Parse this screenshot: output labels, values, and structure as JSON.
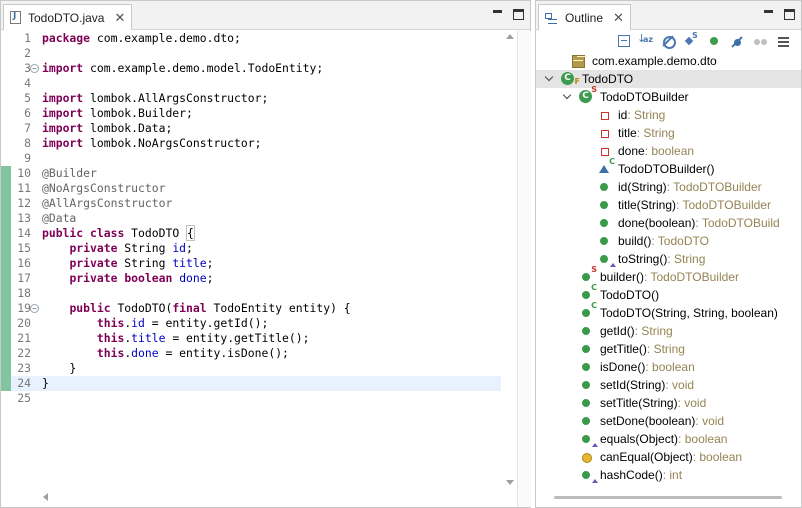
{
  "editor": {
    "tab_title": "TodoDTO.java",
    "tab_close": "✕",
    "lines": [
      {
        "n": "1",
        "segs": [
          {
            "t": "package",
            "c": "kw"
          },
          {
            "t": " com.example.demo.dto;"
          }
        ]
      },
      {
        "n": "2",
        "segs": []
      },
      {
        "n": "3",
        "fold": true,
        "segs": [
          {
            "t": "import",
            "c": "kw"
          },
          {
            "t": " com.example.demo.model.TodoEntity;"
          }
        ]
      },
      {
        "n": "4",
        "segs": []
      },
      {
        "n": "5",
        "segs": [
          {
            "t": "import",
            "c": "kw"
          },
          {
            "t": " lombok.AllArgsConstructor;"
          }
        ]
      },
      {
        "n": "6",
        "segs": [
          {
            "t": "import",
            "c": "kw"
          },
          {
            "t": " lombok.Builder;"
          }
        ]
      },
      {
        "n": "7",
        "segs": [
          {
            "t": "import",
            "c": "kw"
          },
          {
            "t": " lombok.Data;"
          }
        ]
      },
      {
        "n": "8",
        "segs": [
          {
            "t": "import",
            "c": "kw"
          },
          {
            "t": " lombok.NoArgsConstructor;"
          }
        ]
      },
      {
        "n": "9",
        "segs": []
      },
      {
        "n": "10",
        "mark": true,
        "segs": [
          {
            "t": "@Builder",
            "c": "ann"
          }
        ]
      },
      {
        "n": "11",
        "mark": true,
        "segs": [
          {
            "t": "@NoArgsConstructor",
            "c": "ann"
          }
        ]
      },
      {
        "n": "12",
        "mark": true,
        "segs": [
          {
            "t": "@AllArgsConstructor",
            "c": "ann"
          }
        ]
      },
      {
        "n": "13",
        "mark": true,
        "segs": [
          {
            "t": "@Data",
            "c": "ann"
          }
        ]
      },
      {
        "n": "14",
        "mark": true,
        "segs": [
          {
            "t": "public",
            "c": "kw"
          },
          {
            "t": " "
          },
          {
            "t": "class",
            "c": "kw"
          },
          {
            "t": " TodoDTO "
          },
          {
            "t": "{",
            "c": "cursor-box"
          }
        ]
      },
      {
        "n": "15",
        "mark": true,
        "segs": [
          {
            "t": "    "
          },
          {
            "t": "private",
            "c": "kw"
          },
          {
            "t": " String "
          },
          {
            "t": "id",
            "c": "fld"
          },
          {
            "t": ";"
          }
        ]
      },
      {
        "n": "16",
        "mark": true,
        "segs": [
          {
            "t": "    "
          },
          {
            "t": "private",
            "c": "kw"
          },
          {
            "t": " String "
          },
          {
            "t": "title",
            "c": "fld"
          },
          {
            "t": ";"
          }
        ]
      },
      {
        "n": "17",
        "mark": true,
        "segs": [
          {
            "t": "    "
          },
          {
            "t": "private",
            "c": "kw"
          },
          {
            "t": " "
          },
          {
            "t": "boolean",
            "c": "kw"
          },
          {
            "t": " "
          },
          {
            "t": "done",
            "c": "fld"
          },
          {
            "t": ";"
          }
        ]
      },
      {
        "n": "18",
        "mark": true,
        "segs": []
      },
      {
        "n": "19",
        "mark": true,
        "fold": true,
        "segs": [
          {
            "t": "    "
          },
          {
            "t": "public",
            "c": "kw"
          },
          {
            "t": " TodoDTO("
          },
          {
            "t": "final",
            "c": "kw"
          },
          {
            "t": " TodoEntity entity) {"
          }
        ]
      },
      {
        "n": "20",
        "mark": true,
        "segs": [
          {
            "t": "        "
          },
          {
            "t": "this",
            "c": "kw"
          },
          {
            "t": "."
          },
          {
            "t": "id",
            "c": "fld"
          },
          {
            "t": " = entity.getId();"
          }
        ]
      },
      {
        "n": "21",
        "mark": true,
        "segs": [
          {
            "t": "        "
          },
          {
            "t": "this",
            "c": "kw"
          },
          {
            "t": "."
          },
          {
            "t": "title",
            "c": "fld"
          },
          {
            "t": " = entity.getTitle();"
          }
        ]
      },
      {
        "n": "22",
        "mark": true,
        "segs": [
          {
            "t": "        "
          },
          {
            "t": "this",
            "c": "kw"
          },
          {
            "t": "."
          },
          {
            "t": "done",
            "c": "fld"
          },
          {
            "t": " = entity.isDone();"
          }
        ]
      },
      {
        "n": "23",
        "mark": true,
        "segs": [
          {
            "t": "    }"
          }
        ]
      },
      {
        "n": "24",
        "mark": true,
        "current": true,
        "segs": [
          {
            "t": "}"
          }
        ]
      },
      {
        "n": "25",
        "segs": []
      }
    ]
  },
  "outline": {
    "tab_title": "Outline",
    "tab_close": "✕",
    "toolbar": [
      "collapse-all",
      "sort",
      "hide-fields",
      "hide-static",
      "hide-non-public",
      "hide-local-types",
      "more",
      "view-menu"
    ],
    "items": [
      {
        "depth": 0,
        "icon": "package",
        "name": "com.example.demo.dto",
        "type": ""
      },
      {
        "depth": 0,
        "twisty": true,
        "icon": "class",
        "sup": "F",
        "selected": true,
        "name": "TodoDTO",
        "type": ""
      },
      {
        "depth": 1,
        "twisty": true,
        "icon": "class",
        "sup": "S",
        "name": "TodoDTOBuilder",
        "type": ""
      },
      {
        "depth": 2,
        "icon": "field",
        "name": "id",
        "type": " : String"
      },
      {
        "depth": 2,
        "icon": "field",
        "name": "title",
        "type": " : String"
      },
      {
        "depth": 2,
        "icon": "field",
        "name": "done",
        "type": " : boolean"
      },
      {
        "depth": 2,
        "icon": "ctor-pkg",
        "sup": "C",
        "name": "TodoDTOBuilder()",
        "type": ""
      },
      {
        "depth": 2,
        "icon": "method",
        "name": "id(String)",
        "type": " : TodoDTOBuilder"
      },
      {
        "depth": 2,
        "icon": "method",
        "name": "title(String)",
        "type": " : TodoDTOBuilder"
      },
      {
        "depth": 2,
        "icon": "method",
        "name": "done(boolean)",
        "type": " : TodoDTOBuild"
      },
      {
        "depth": 2,
        "icon": "method",
        "name": "build()",
        "type": " : TodoDTO"
      },
      {
        "depth": 2,
        "icon": "method",
        "tri": true,
        "name": "toString()",
        "type": " : String"
      },
      {
        "depth": 1,
        "icon": "method",
        "sup": "S",
        "name": "builder()",
        "type": " : TodoDTOBuilder"
      },
      {
        "depth": 1,
        "icon": "method",
        "sup": "C",
        "name": "TodoDTO()",
        "type": ""
      },
      {
        "depth": 1,
        "icon": "method",
        "sup": "C",
        "name": "TodoDTO(String, String, boolean)",
        "type": ""
      },
      {
        "depth": 1,
        "icon": "method",
        "name": "getId()",
        "type": " : String"
      },
      {
        "depth": 1,
        "icon": "method",
        "name": "getTitle()",
        "type": " : String"
      },
      {
        "depth": 1,
        "icon": "method",
        "name": "isDone()",
        "type": " : boolean"
      },
      {
        "depth": 1,
        "icon": "method",
        "name": "setId(String)",
        "type": " : void"
      },
      {
        "depth": 1,
        "icon": "method",
        "name": "setTitle(String)",
        "type": " : void"
      },
      {
        "depth": 1,
        "icon": "method",
        "name": "setDone(boolean)",
        "type": " : void"
      },
      {
        "depth": 1,
        "icon": "method",
        "tri": true,
        "name": "equals(Object)",
        "type": " : boolean"
      },
      {
        "depth": 1,
        "icon": "method-prot",
        "name": "canEqual(Object)",
        "type": " : boolean"
      },
      {
        "depth": 1,
        "icon": "method",
        "tri": true,
        "name": "hashCode()",
        "type": " : int"
      }
    ]
  }
}
